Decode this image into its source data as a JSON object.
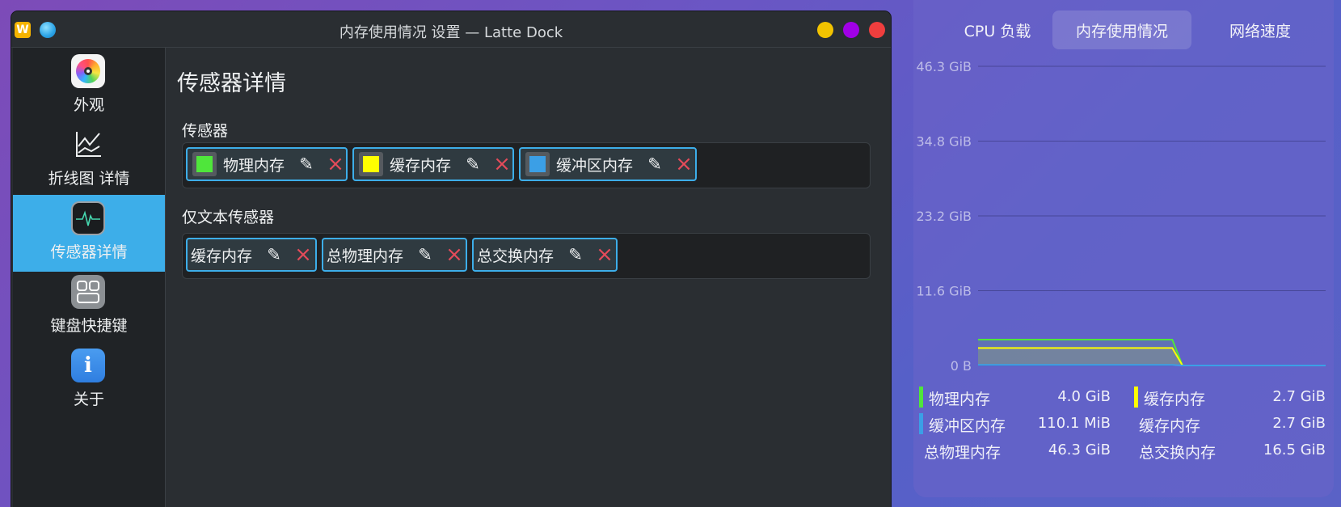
{
  "window": {
    "title": "内存使用情况 设置 — Latte Dock",
    "app_icon_letter": "W"
  },
  "sidebar": {
    "items": [
      {
        "label": "外观",
        "icon": "appearance-icon"
      },
      {
        "label": "折线图 详情",
        "icon": "line-chart-icon"
      },
      {
        "label": "传感器详情",
        "icon": "sensor-monitor-icon",
        "active": true
      },
      {
        "label": "键盘快捷键",
        "icon": "keyboard-shortcut-icon"
      },
      {
        "label": "关于",
        "icon": "info-icon"
      }
    ]
  },
  "content": {
    "title": "传感器详情",
    "sensors_label": "传感器",
    "sensors": [
      {
        "name": "物理内存",
        "color": "#4fe63b"
      },
      {
        "name": "缓存内存",
        "color": "#ffff00"
      },
      {
        "name": "缓冲区内存",
        "color": "#3b9fe6"
      }
    ],
    "text_only_label": "仅文本传感器",
    "text_only_sensors": [
      {
        "name": "缓存内存"
      },
      {
        "name": "总物理内存"
      },
      {
        "name": "总交换内存"
      }
    ]
  },
  "widget": {
    "tabs": [
      "CPU 负载",
      "内存使用情况",
      "网络速度"
    ],
    "active_tab": 1,
    "legend": [
      {
        "name": "物理内存",
        "value": "4.0 GiB",
        "color": "#4fe63b"
      },
      {
        "name": "缓存内存",
        "value": "2.7 GiB",
        "color": "#ffff00"
      },
      {
        "name": "缓冲区内存",
        "value": "110.1 MiB",
        "color": "#3b9fe6"
      },
      {
        "name": "缓存内存",
        "value": "2.7 GiB",
        "color": ""
      },
      {
        "name": "总物理内存",
        "value": "46.3 GiB",
        "color": ""
      },
      {
        "name": "总交换内存",
        "value": "16.5 GiB",
        "color": ""
      }
    ]
  },
  "chart_data": {
    "type": "area",
    "y_tick_labels": [
      "46.3 GiB",
      "34.8 GiB",
      "23.2 GiB",
      "11.6 GiB",
      "0 B"
    ],
    "ylim": [
      0,
      46.3
    ],
    "grid": true,
    "x_samples": 35,
    "series": [
      {
        "name": "物理内存",
        "color": "#4fe63b",
        "values": [
          4.0,
          4.0,
          4.0,
          4.0,
          4.0,
          4.0,
          4.0,
          4.0,
          4.0,
          4.0,
          4.0,
          4.0,
          4.0,
          4.0,
          4.0,
          4.0,
          4.0,
          4.0,
          4.0,
          4.0,
          0,
          0,
          0,
          0,
          0,
          0,
          0,
          0,
          0,
          0,
          0,
          0,
          0,
          0,
          0
        ]
      },
      {
        "name": "缓存内存",
        "color": "#ffff00",
        "values": [
          2.7,
          2.7,
          2.7,
          2.7,
          2.7,
          2.7,
          2.7,
          2.7,
          2.7,
          2.7,
          2.7,
          2.7,
          2.7,
          2.7,
          2.7,
          2.7,
          2.7,
          2.7,
          2.7,
          2.7,
          0,
          0,
          0,
          0,
          0,
          0,
          0,
          0,
          0,
          0,
          0,
          0,
          0,
          0,
          0
        ]
      },
      {
        "name": "缓冲区内存",
        "color": "#3b9fe6",
        "values": [
          0.1,
          0.1,
          0.1,
          0.1,
          0.1,
          0.1,
          0.1,
          0.1,
          0.1,
          0.1,
          0.1,
          0.1,
          0.1,
          0.1,
          0.1,
          0.1,
          0.1,
          0.1,
          0.1,
          0.1,
          0,
          0,
          0,
          0,
          0,
          0,
          0,
          0,
          0,
          0,
          0,
          0,
          0,
          0,
          0
        ]
      }
    ]
  }
}
